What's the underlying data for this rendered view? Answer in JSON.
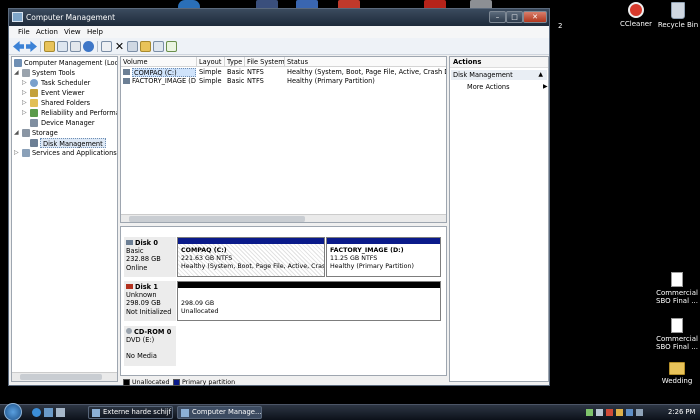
{
  "desktop": {
    "top_clip_text": "2",
    "icons": [
      {
        "id": "ccleaner",
        "label": "CCleaner"
      },
      {
        "id": "recycle-bin",
        "label": "Recycle Bin"
      },
      {
        "id": "commercial-1",
        "label": "Commercial SBO Final ..."
      },
      {
        "id": "commercial-2",
        "label": "Commercial SBO Final ..."
      },
      {
        "id": "wedding",
        "label": "Wedding"
      }
    ]
  },
  "window": {
    "title": "Computer Management",
    "buttons": {
      "minimize": "–",
      "maximize": "□",
      "close": "✕"
    },
    "menu": [
      "File",
      "Action",
      "View",
      "Help"
    ],
    "toolbar_icons": [
      "back-arrow-icon",
      "forward-arrow-icon",
      "up-folder-icon",
      "show-hide-tree-icon",
      "properties-icon",
      "help-icon",
      "export-list-icon",
      "delete-icon",
      "properties-sheet-icon",
      "open-folder-icon",
      "view-icon",
      "checklist-icon"
    ]
  },
  "tree": {
    "root": "Computer Management (Local",
    "items": [
      {
        "label": "System Tools",
        "level": 1,
        "expander": "◢"
      },
      {
        "label": "Task Scheduler",
        "level": 2,
        "expander": "▷"
      },
      {
        "label": "Event Viewer",
        "level": 2,
        "expander": "▷"
      },
      {
        "label": "Shared Folders",
        "level": 2,
        "expander": "▷"
      },
      {
        "label": "Reliability and Performa",
        "level": 2,
        "expander": "▷"
      },
      {
        "label": "Device Manager",
        "level": 2,
        "expander": ""
      },
      {
        "label": "Storage",
        "level": 1,
        "expander": "◢"
      },
      {
        "label": "Disk Management",
        "level": 2,
        "expander": ""
      },
      {
        "label": "Services and Applications",
        "level": 1,
        "expander": "▷"
      }
    ]
  },
  "volume_list": {
    "columns": [
      "Volume",
      "Layout",
      "Type",
      "File System",
      "Status"
    ],
    "rows": [
      {
        "volume": "COMPAQ (C:)",
        "layout": "Simple",
        "type": "Basic",
        "fs": "NTFS",
        "status": "Healthy (System, Boot, Page File, Active, Crash Dump, P"
      },
      {
        "volume": "FACTORY_IMAGE (D:)",
        "layout": "Simple",
        "type": "Basic",
        "fs": "NTFS",
        "status": "Healthy (Primary Partition)"
      }
    ]
  },
  "disks": [
    {
      "name": "Disk 0",
      "type": "Basic",
      "size": "232.88 GB",
      "state": "Online"
    },
    {
      "name": "Disk 1",
      "type": "Unknown",
      "size": "298.09 GB",
      "state": "Not Initialized"
    },
    {
      "name": "CD-ROM 0",
      "type": "DVD (E:)",
      "size": "",
      "state": "No Media"
    }
  ],
  "partitions": {
    "c": {
      "name": "COMPAQ  (C:)",
      "size": "221.63 GB NTFS",
      "status": "Healthy (System, Boot, Page File, Active, Crash D"
    },
    "d": {
      "name": "FACTORY_IMAGE  (D:)",
      "size": "11.25 GB NTFS",
      "status": "Healthy (Primary Partition)"
    },
    "disk1": {
      "size": "298.09 GB",
      "status": "Unallocated"
    }
  },
  "legend": [
    "Unallocated",
    "Primary partition"
  ],
  "actions": {
    "header": "Actions",
    "section": "Disk Management",
    "more": "More Actions"
  },
  "taskbar": {
    "tasks": [
      "Externe harde schijf ...",
      "Computer Manage..."
    ],
    "time": "2:26 PM"
  },
  "colors": {
    "primary_partition": "#0a1a8a",
    "unallocated": "#000000",
    "selection": "#cfe3fb"
  }
}
